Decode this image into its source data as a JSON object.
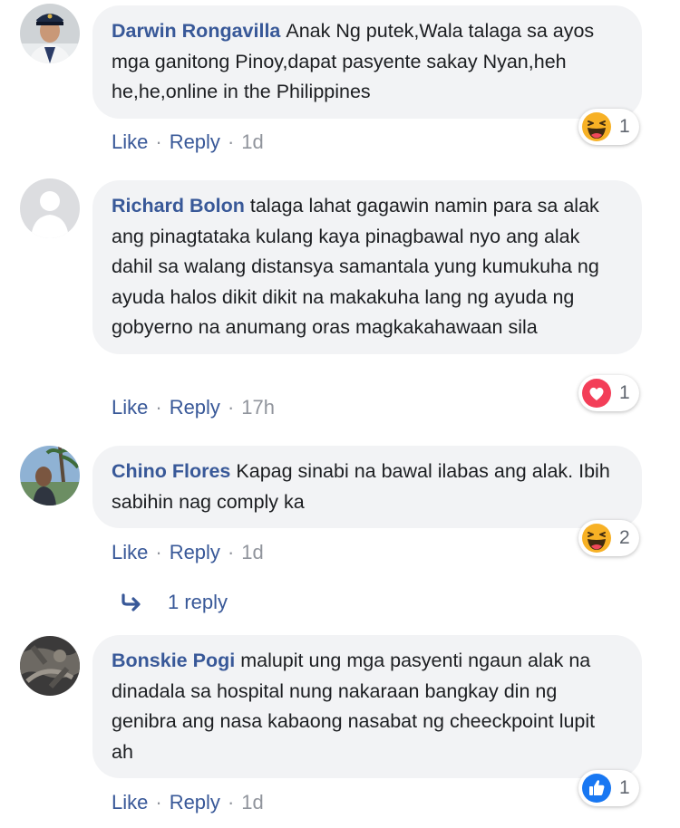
{
  "actions": {
    "like": "Like",
    "reply": "Reply"
  },
  "comments": [
    {
      "author": "Darwin Rongavilla",
      "text": "Anak Ng putek,Wala talaga sa ayos mga ganitong Pinoy,dapat pasyente sakay Nyan,heh he,he,online in the Philippines",
      "time": "1d",
      "reaction": {
        "icon": "haha-reaction-icon",
        "count": "1"
      }
    },
    {
      "author": "Richard Bolon",
      "text": "talaga lahat gagawin namin para sa alak ang pinagtataka kulang kaya pinagbawal nyo ang alak dahil sa walang distansya samantala yung kumukuha ng ayuda halos dikit dikit na makakuha lang ng ayuda ng gobyerno na anumang oras magkakahawaan sila",
      "time": "17h",
      "reaction": {
        "icon": "love-reaction-icon",
        "count": "1"
      }
    },
    {
      "author": "Chino Flores",
      "text": "Kapag sinabi na bawal ilabas ang alak. Ibih sabihin nag comply ka",
      "time": "1d",
      "reaction": {
        "icon": "haha-reaction-icon",
        "count": "2"
      },
      "replies": "1 reply"
    },
    {
      "author": "Bonskie Pogi",
      "text": "malupit ung mga pasyenti ngaun alak na dinadala sa hospital nung nakaraan bangkay din ng genibra ang nasa kabaong nasabat ng cheeckpoint lupit ah",
      "time": "1d",
      "reaction": {
        "icon": "like-reaction-icon",
        "count": "1"
      }
    }
  ],
  "colors": {
    "author": "#385898",
    "bubble": "#f2f3f5",
    "meta": "#90949c",
    "haha": "#f7b125",
    "love": "#f33e58",
    "like": "#1877f2"
  }
}
